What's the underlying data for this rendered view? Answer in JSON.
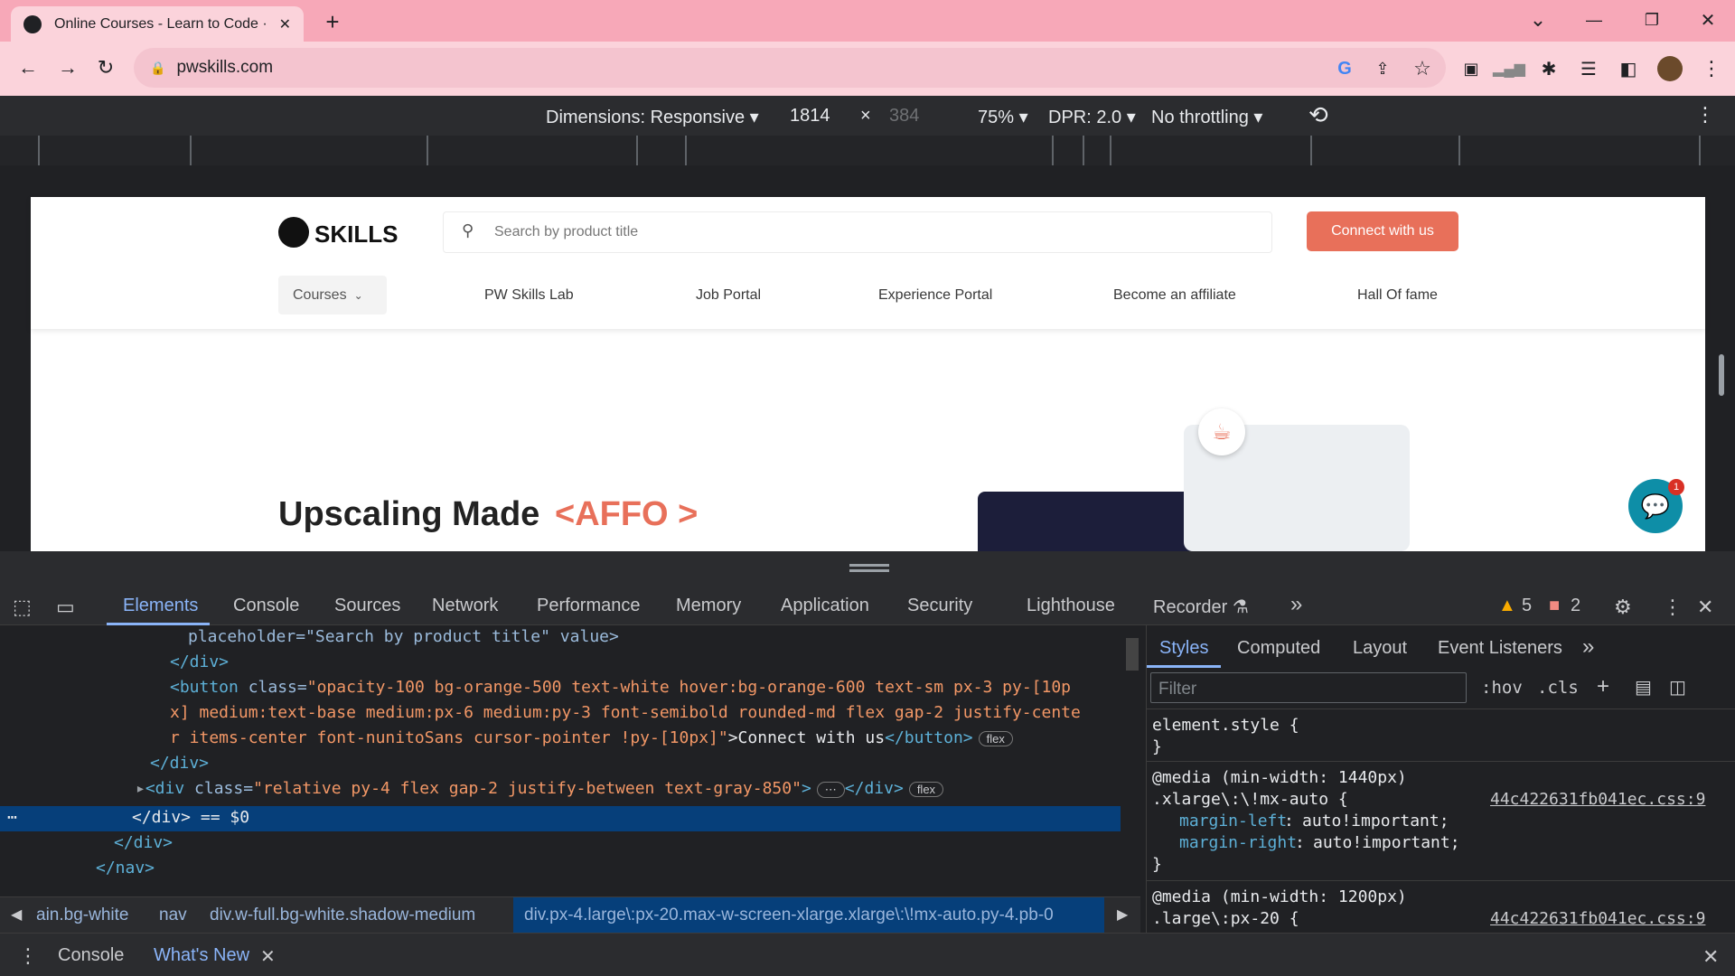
{
  "browser": {
    "tab_title": "Online Courses - Learn to Code ·",
    "url": "pwskills.com",
    "new_tab": "+",
    "win_min": "—",
    "win_max": "❐",
    "win_close": "✕",
    "tab_close": "✕",
    "chevron": "⌄"
  },
  "device_toolbar": {
    "dimensions": "Dimensions: Responsive ▾",
    "width": "1814",
    "times": "×",
    "height": "384",
    "zoom": "75% ▾",
    "dpr": "DPR: 2.0 ▾",
    "throttle": "No throttling ▾"
  },
  "site": {
    "logo_text": "SKILLS",
    "search_placeholder": "Search by product title",
    "connect": "Connect with us",
    "courses": "Courses",
    "nav": [
      "PW Skills Lab",
      "Job Portal",
      "Experience Portal",
      "Become an affiliate",
      "Hall Of fame"
    ],
    "hero_title": "Upscaling Made",
    "hero_accent": "<AFFO >",
    "chat_badge": "1"
  },
  "devtools": {
    "tabs": [
      "Elements",
      "Console",
      "Sources",
      "Network",
      "Performance",
      "Memory",
      "Application",
      "Security",
      "Lighthouse",
      "Recorder ⚗"
    ],
    "more": "»",
    "warnings": "5",
    "errors": "2",
    "code": {
      "l1": "placeholder=\"Search by product title\" value>",
      "l2": "</div>",
      "l3a": "<button ",
      "l3b": "class=",
      "l3c": "\"opacity-100 bg-orange-500 text-white hover:bg-orange-600 text-sm px-3 py-[10p",
      "l4": "x] medium:text-base medium:px-6 medium:py-3 font-semibold rounded-md flex gap-2 justify-cente",
      "l5a": "r items-center font-nunitoSans cursor-pointer !py-[10px]\"",
      "l5b": ">Connect with us",
      "l5c": "</button>",
      "l5badge": "flex",
      "l6": "</div>",
      "l7a": "<div ",
      "l7b": "class=",
      "l7c": "\"relative py-4 flex gap-2 justify-between text-gray-850\"",
      "l7d": ">",
      "l7e": "</div>",
      "l7badge": "flex",
      "l8": "</div> == $0",
      "l9": "</div>",
      "l10": "</nav>"
    },
    "breadcrumbs": [
      "ain.bg-white",
      "nav",
      "div.w-full.bg-white.shadow-medium",
      "div.px-4.large\\:px-20.max-w-screen-xlarge.xlarge\\:\\!mx-auto.py-4.pb-0"
    ],
    "styles_tabs": [
      "Styles",
      "Computed",
      "Layout",
      "Event Listeners"
    ],
    "filter_placeholder": "Filter",
    "hov": ":hov",
    "cls": ".cls",
    "styles": {
      "s1": "element.style {",
      "s2": "}",
      "s3": "@media (min-width: 1440px)",
      "s4": ".xlarge\\:\\!mx-auto {",
      "s4link": "44c422631fb041ec.css:9",
      "s5p": "margin-left",
      "s5v": "auto!important;",
      "s6p": "margin-right",
      "s6v": "auto!important;",
      "s7": "}",
      "s8": "@media (min-width: 1200px)",
      "s9": ".large\\:px-20 {",
      "s9link": "44c422631fb041ec.css:9"
    },
    "drawer_tabs": [
      "Console",
      "What's New"
    ]
  }
}
